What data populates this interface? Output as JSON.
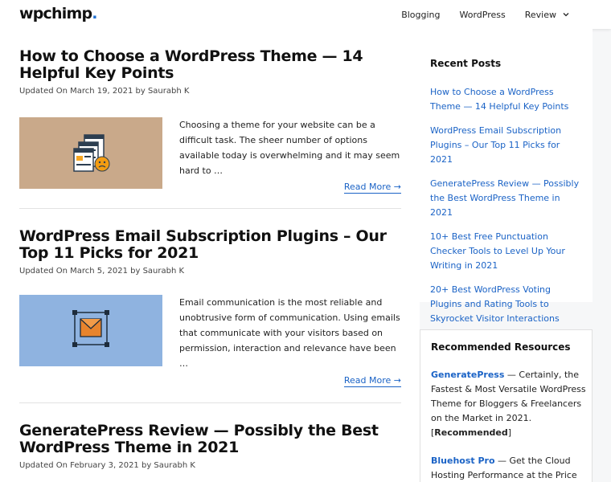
{
  "header": {
    "logo": {
      "text": "wpchimp",
      "dot": "."
    },
    "nav": [
      {
        "label": "Blogging"
      },
      {
        "label": "WordPress"
      },
      {
        "label": "Review",
        "has_dropdown": true
      }
    ]
  },
  "posts": [
    {
      "title": "How to Choose a WordPress Theme — 14 Helpful Key Points",
      "meta": "Updated On March 19, 2021 by Saurabh K",
      "excerpt": "Choosing a theme for your website can be a difficult task. The sheer number of options available today is overwhelming and it may seem hard to …",
      "read_more": "Read More →",
      "thumb_color": "#c9a98a"
    },
    {
      "title": "WordPress Email Subscription Plugins – Our Top 11 Picks for 2021",
      "meta": "Updated On March 5, 2021 by Saurabh K",
      "excerpt": "Email communication is the most reliable and unobtrusive form of communication. Using emails that communicate with your visitors based on permission, interaction and relevance have been …",
      "read_more": "Read More →",
      "thumb_color": "#8fb3e0"
    },
    {
      "title": "GeneratePress Review — Possibly the Best WordPress Theme in 2021",
      "meta": "Updated On February 3, 2021 by Saurabh K"
    }
  ],
  "sidebar": {
    "recent_title": "Recent Posts",
    "recent_posts": [
      "How to Choose a WordPress Theme — 14 Helpful Key Points",
      "WordPress Email Subscription Plugins – Our Top 11 Picks for 2021",
      "GeneratePress Review — Possibly the Best WordPress Theme in 2021",
      "10+ Best Free Punctuation Checker Tools to Level Up Your Writing in 2021",
      "20+ Best WordPress Voting Plugins and Rating Tools to Skyrocket Visitor Interactions"
    ],
    "resources_title": "Recommended Resources",
    "resources": [
      {
        "brand": "GeneratePress",
        "text": " — Certainly, the Fastest & Most Versatile WordPress Theme for Bloggers & Freelancers on the Market in 2021. [",
        "tag": "Recommended",
        "end": "]"
      },
      {
        "brand": "Bluehost Pro",
        "text": " — Get the Cloud Hosting Performance at the Price of"
      }
    ]
  },
  "colors": {
    "link": "#1b63c6",
    "logo_dot": "#1f6fd1",
    "thumb1_bg": "#c9a98a",
    "thumb2_bg": "#8fb3e0"
  }
}
